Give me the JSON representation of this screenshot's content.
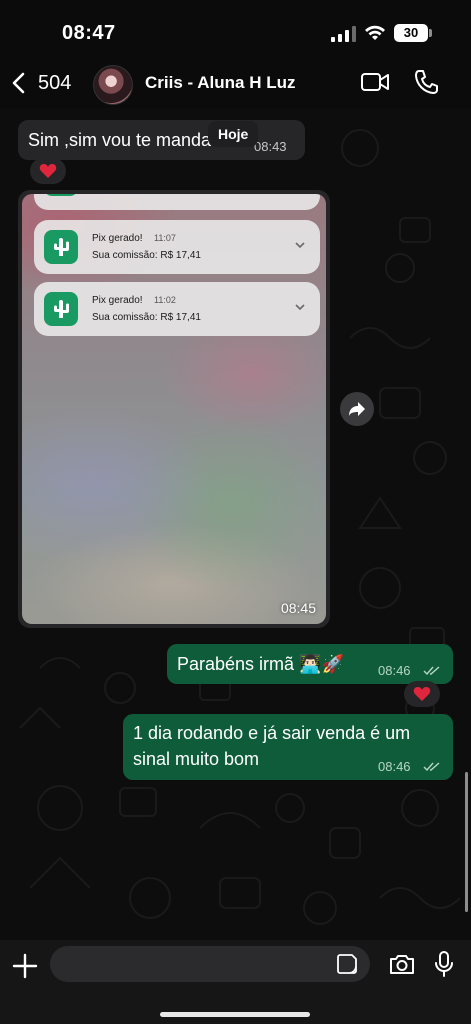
{
  "status_bar": {
    "time": "08:47",
    "battery": "30"
  },
  "header": {
    "back_count": "504",
    "contact_name": "Criis - Aluna H Luz"
  },
  "chat": {
    "date_chip": "Hoje",
    "messages": [
      {
        "text": "Sim ,sim vou te mandar",
        "time": "08:43",
        "reaction": "heart"
      },
      {
        "media_time": "08:45"
      },
      {
        "text": "Parabéns irmã 👨🏻‍💻🚀",
        "time": "08:46",
        "reaction": "heart"
      },
      {
        "text": "1 dia rodando e já sair venda é um sinal muito bom",
        "time": "08:46"
      }
    ],
    "notifications": [
      {
        "title": "Pix gerado!",
        "time": "11:07",
        "subtitle": "Sua comissão: R$ 17,41"
      },
      {
        "title": "Pix gerado!",
        "time": "11:02",
        "subtitle": "Sua comissão: R$ 17,41"
      }
    ]
  },
  "input": {
    "placeholder": ""
  },
  "colors": {
    "outgoing": "#0e5c3a",
    "incoming": "#262628",
    "background": "#0d0d0d",
    "app_icon": "#1a9a63"
  }
}
